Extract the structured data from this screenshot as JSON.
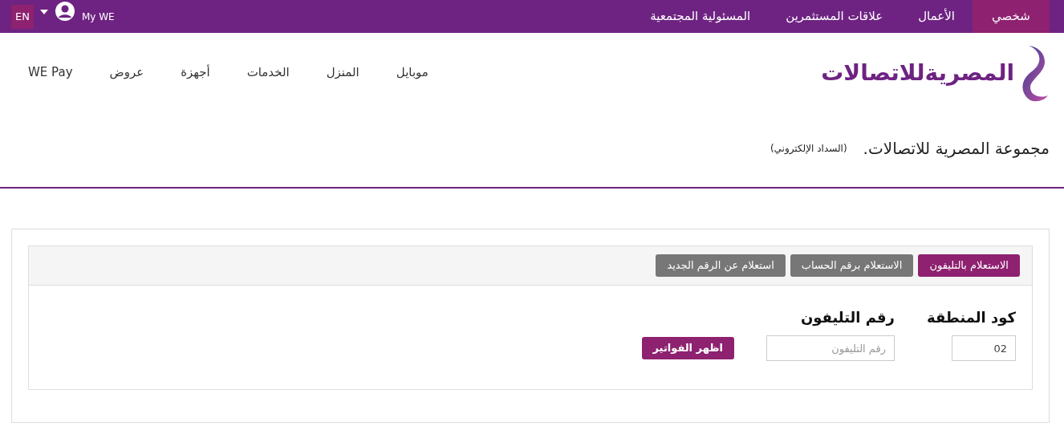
{
  "top_bar": {
    "language": "EN",
    "account": "My WE",
    "tabs": [
      {
        "label": "شخصي",
        "selected": true
      },
      {
        "label": "الأعمال",
        "selected": false
      },
      {
        "label": "علاقات المستثمرين",
        "selected": false
      },
      {
        "label": "المسئولية المجتمعية",
        "selected": false
      }
    ]
  },
  "logo": {
    "text": "المصريةللاتصالات"
  },
  "nav": [
    "موبايل",
    "المنزل",
    "الخدمات",
    "أجهزة",
    "عروض",
    "WE Pay"
  ],
  "page_title": {
    "title": "مجموعة المصرية للاتصالات.",
    "subtitle": "(السداد الإلكتروني)"
  },
  "inquiry": {
    "tabs": [
      {
        "label": "الاستعلام بالتليفون",
        "selected": true
      },
      {
        "label": "الاستعلام برقم الحساب",
        "selected": false
      },
      {
        "label": "استعلام عن الرقم الجديد",
        "selected": false
      }
    ],
    "area_code": {
      "label": "كود المنطقة",
      "value": "02"
    },
    "phone": {
      "label": "رقم التليفون",
      "placeholder": "رقم التليفون"
    },
    "submit": "اظهر الفواتير"
  }
}
